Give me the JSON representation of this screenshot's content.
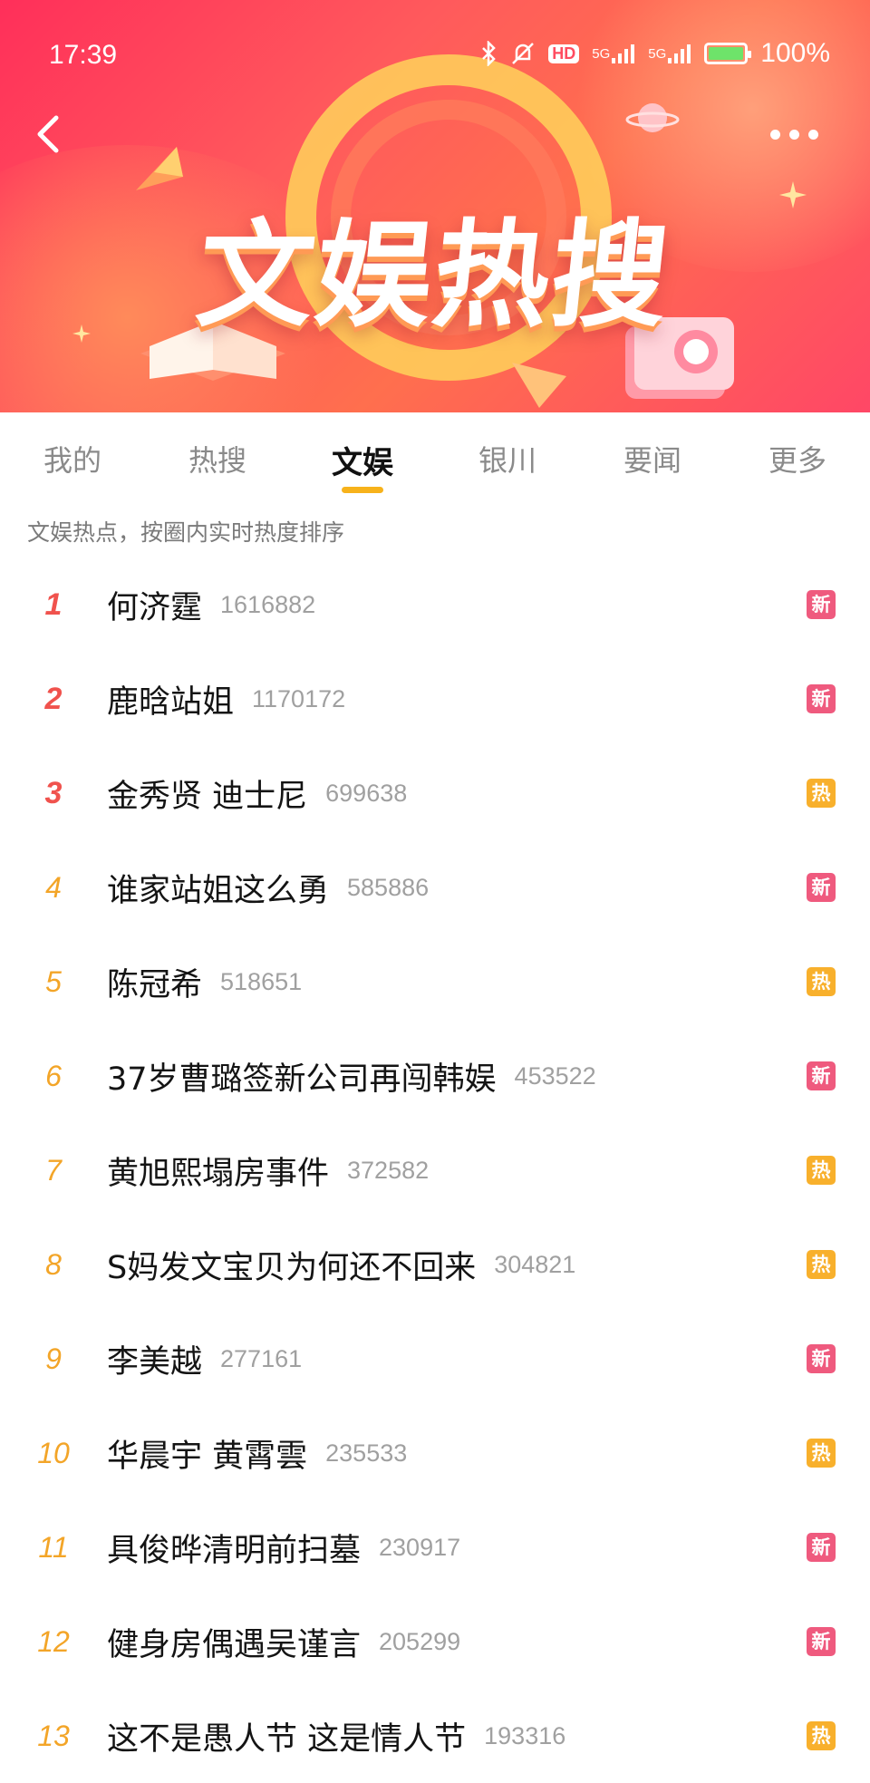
{
  "status_bar": {
    "time": "17:39",
    "network1": "5G",
    "network2": "5G",
    "hd": "HD",
    "battery": "100%"
  },
  "banner": {
    "title": "文娱热搜"
  },
  "tabs": [
    {
      "label": "我的",
      "active": false
    },
    {
      "label": "热搜",
      "active": false
    },
    {
      "label": "文娱",
      "active": true
    },
    {
      "label": "银川",
      "active": false
    },
    {
      "label": "要闻",
      "active": false
    },
    {
      "label": "更多",
      "active": false
    }
  ],
  "subtitle": "文娱热点，按圈内实时热度排序",
  "colors": {
    "rank_top": "#f0524d",
    "rank_rest": "#f3a528",
    "badge_new": "#ef5a7e",
    "badge_hot": "#f8b02c",
    "tab_indicator": "#f7b21b"
  },
  "items": [
    {
      "rank": "1",
      "title": "何济霆",
      "count": "1616882",
      "badge": "新",
      "badge_type": "new"
    },
    {
      "rank": "2",
      "title": "鹿晗站姐",
      "count": "1170172",
      "badge": "新",
      "badge_type": "new"
    },
    {
      "rank": "3",
      "title": "金秀贤 迪士尼",
      "count": "699638",
      "badge": "热",
      "badge_type": "hot"
    },
    {
      "rank": "4",
      "title": "谁家站姐这么勇",
      "count": "585886",
      "badge": "新",
      "badge_type": "new"
    },
    {
      "rank": "5",
      "title": "陈冠希",
      "count": "518651",
      "badge": "热",
      "badge_type": "hot"
    },
    {
      "rank": "6",
      "title": "37岁曹璐签新公司再闯韩娱",
      "count": "453522",
      "badge": "新",
      "badge_type": "new"
    },
    {
      "rank": "7",
      "title": "黄旭熙塌房事件",
      "count": "372582",
      "badge": "热",
      "badge_type": "hot"
    },
    {
      "rank": "8",
      "title": "S妈发文宝贝为何还不回来",
      "count": "304821",
      "badge": "热",
      "badge_type": "hot"
    },
    {
      "rank": "9",
      "title": "李美越",
      "count": "277161",
      "badge": "新",
      "badge_type": "new"
    },
    {
      "rank": "10",
      "title": "华晨宇 黄霄雲",
      "count": "235533",
      "badge": "热",
      "badge_type": "hot"
    },
    {
      "rank": "11",
      "title": "具俊晔清明前扫墓",
      "count": "230917",
      "badge": "新",
      "badge_type": "new"
    },
    {
      "rank": "12",
      "title": "健身房偶遇吴谨言",
      "count": "205299",
      "badge": "新",
      "badge_type": "new"
    },
    {
      "rank": "13",
      "title": "这不是愚人节 这是情人节",
      "count": "193316",
      "badge": "热",
      "badge_type": "hot"
    }
  ]
}
